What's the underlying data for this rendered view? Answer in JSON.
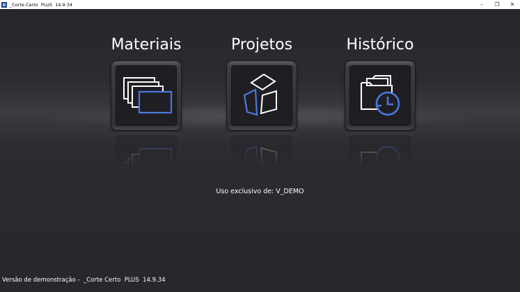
{
  "window": {
    "title": "_Corte Certo  PLUS  14.9.34",
    "minimize_glyph": "–",
    "maximize_glyph": "❐",
    "close_glyph": "✕"
  },
  "tiles": [
    {
      "label": "Materiais",
      "icon": "stacked-sheets-icon"
    },
    {
      "label": "Projetos",
      "icon": "cube-parts-icon"
    },
    {
      "label": "Histórico",
      "icon": "folder-history-icon"
    }
  ],
  "exclusive_text": "Uso exclusivo de: V_DEMO",
  "footer_text": "Versão de demonstração -  _Corte Certo  PLUS  14.9.34",
  "colors": {
    "accent_blue": "#4a78e0",
    "icon_white": "#ffffff",
    "background": "#2a2a2f"
  }
}
